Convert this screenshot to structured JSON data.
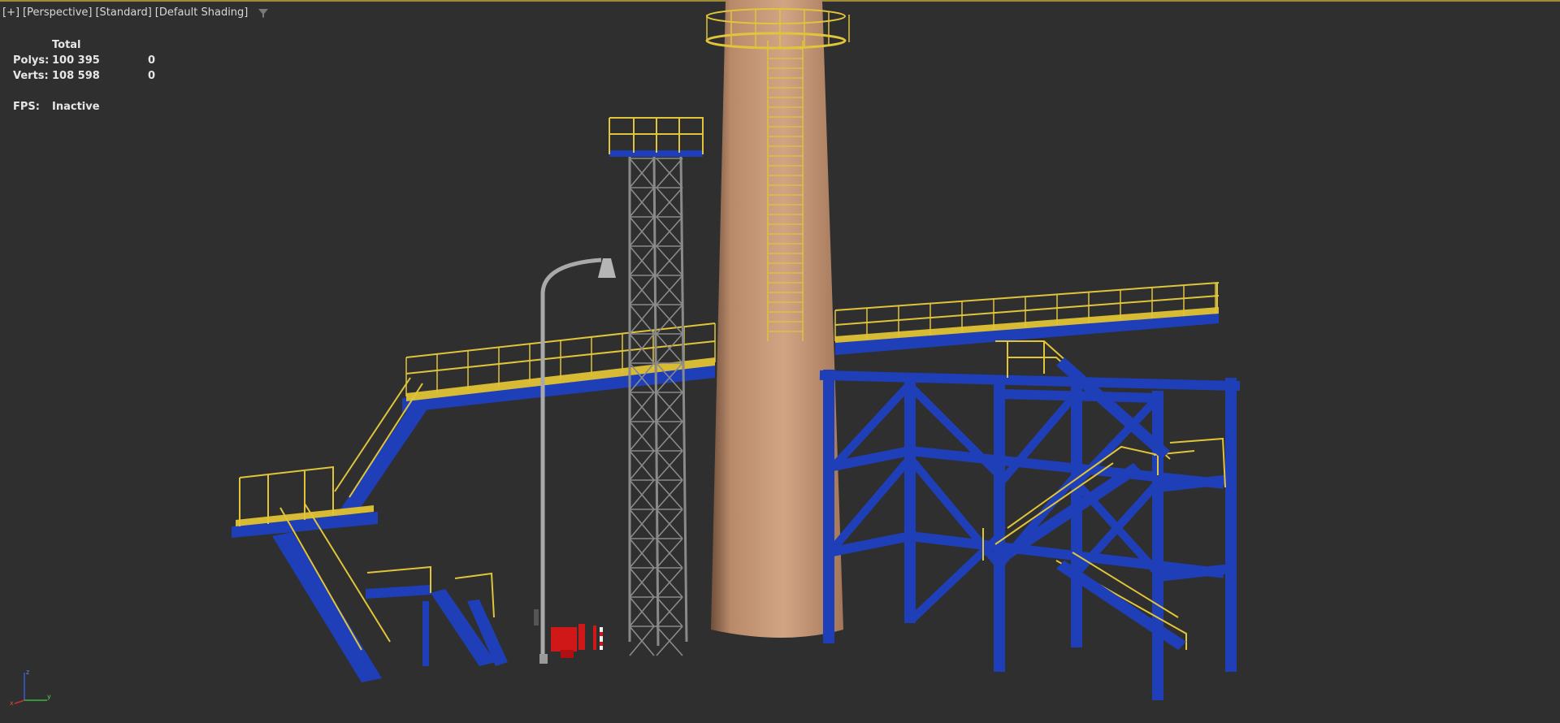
{
  "viewport": {
    "labels": [
      "[+]",
      "[Perspective]",
      "[Standard]",
      "[Default Shading]"
    ],
    "filter_icon": "funnel-icon"
  },
  "stats": {
    "header": "Total",
    "rows": [
      {
        "label": "Polys:",
        "total": "100 395",
        "selected": "0"
      },
      {
        "label": "Verts:",
        "total": "108 598",
        "selected": "0"
      }
    ],
    "fps_label": "FPS:",
    "fps_value": "Inactive"
  },
  "axis_gizmo": {
    "x": "x",
    "y": "y",
    "z": "z"
  },
  "colors": {
    "background": "#2f2f2f",
    "structure_blue": "#1f3fb8",
    "railing_yellow": "#e0c43a",
    "chimney": "#c99a78",
    "tower_gray": "#8a8a8a",
    "equipment_red": "#d01818"
  }
}
